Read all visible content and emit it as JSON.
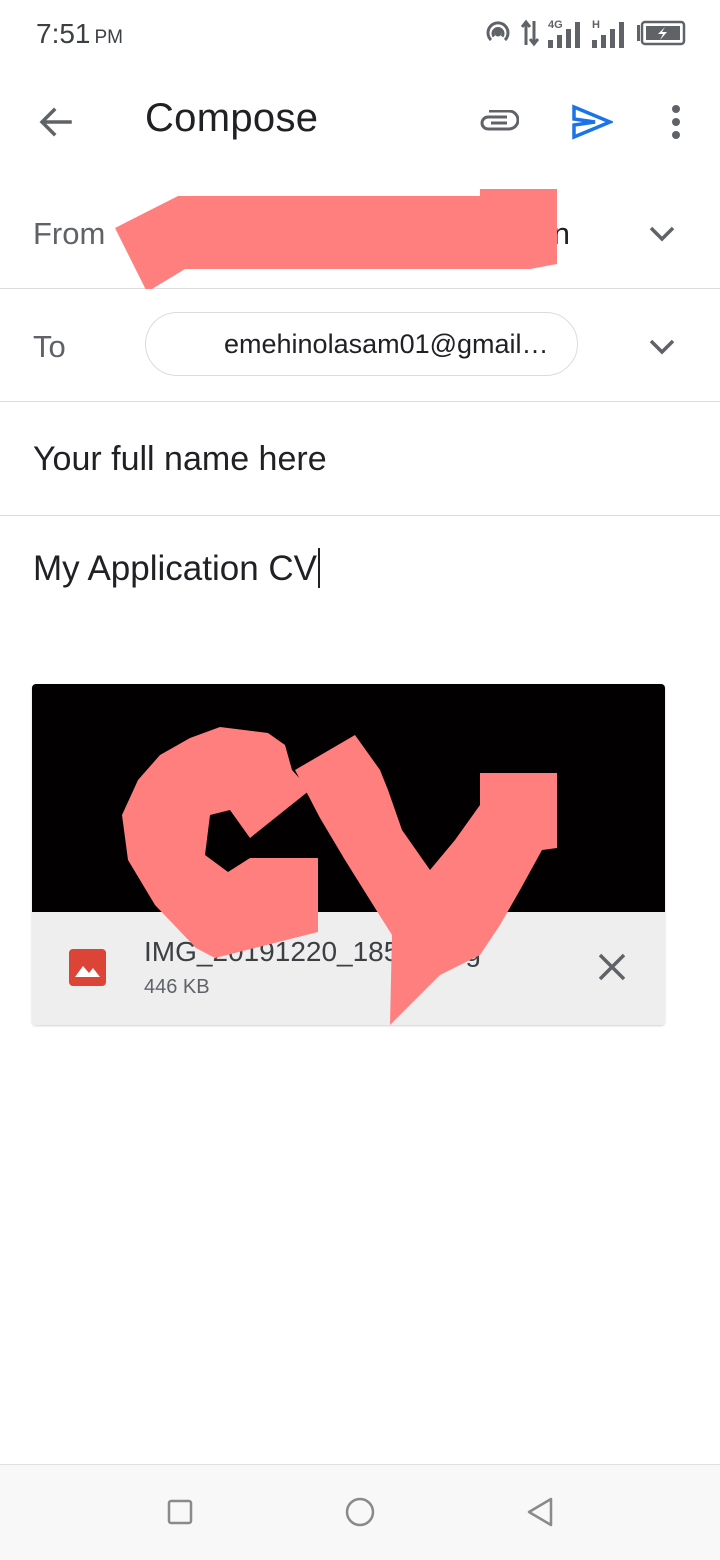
{
  "status_bar": {
    "time": "7:51",
    "ampm": "PM",
    "network_4g": "4G",
    "network_h": "H"
  },
  "app_bar": {
    "title": "Compose",
    "icons": [
      "back-arrow-icon",
      "paperclip-icon",
      "send-icon",
      "more-vert-icon"
    ],
    "send_color": "#1a73e8"
  },
  "from": {
    "label": "From",
    "value_visible": "n"
  },
  "to": {
    "label": "To",
    "recipient": "emehinolasam01@gmail…"
  },
  "subject": {
    "value": "Your full name here"
  },
  "body": {
    "text": "My Application CV"
  },
  "attachment": {
    "file_name": "IMG_20191220_185",
    "file_name_tail": "g",
    "file_size": "446 KB",
    "icon": "image-file-icon",
    "icon_color": "#db4437"
  },
  "redaction_color": "#ff7f7f",
  "nav_bar": {
    "icons": [
      "recent-apps-icon",
      "home-icon",
      "nav-back-icon"
    ]
  }
}
